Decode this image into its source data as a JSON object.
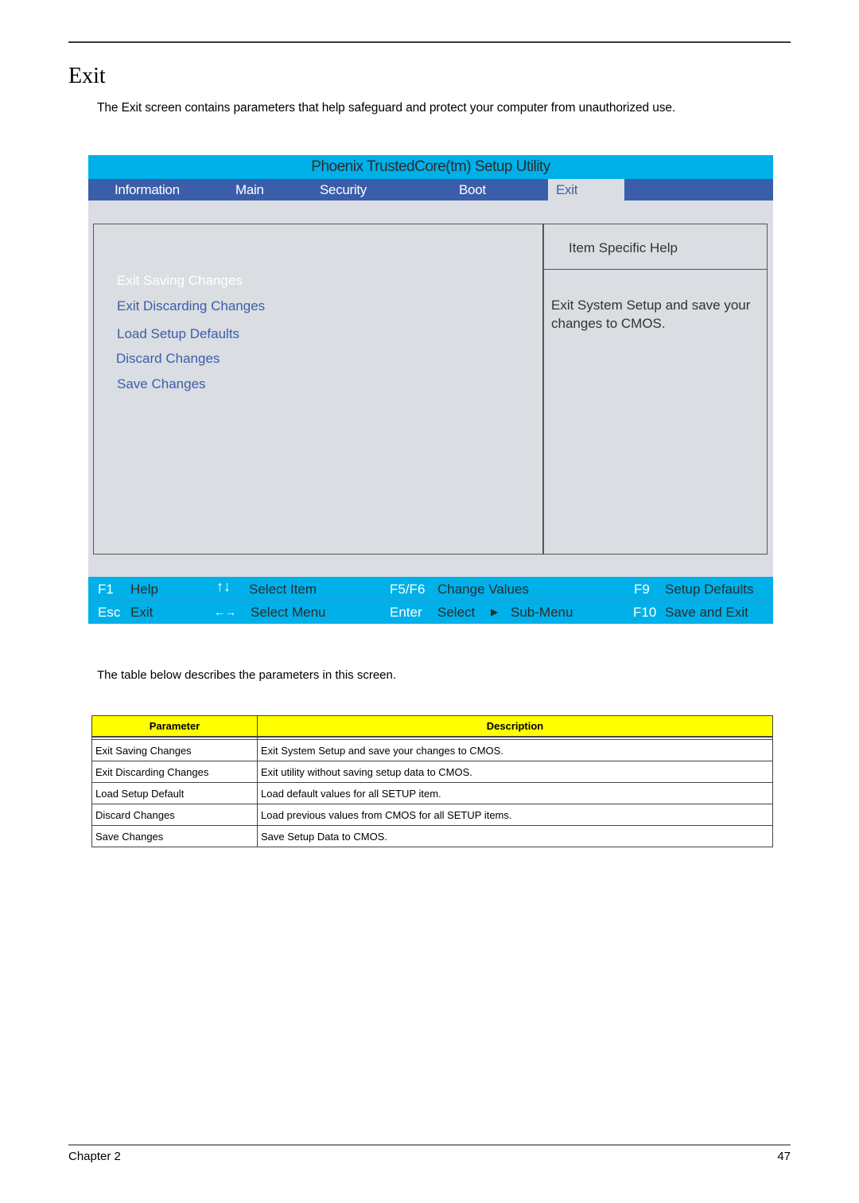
{
  "page": {
    "title": "Exit",
    "intro": "The Exit screen contains parameters that help safeguard and protect your computer from unauthorized use.",
    "table_intro": "The table below describes the parameters in this screen.",
    "footer": {
      "chapter": "Chapter 2",
      "page_number": "47"
    }
  },
  "bios": {
    "title": "Phoenix TrustedCore(tm) Setup Utility",
    "menu": [
      {
        "label": "Information"
      },
      {
        "label": "Main"
      },
      {
        "label": "Security"
      },
      {
        "label": "Boot"
      },
      {
        "label": "Exit",
        "active": true
      }
    ],
    "options": [
      {
        "label": "Exit Saving Changes",
        "selected": true
      },
      {
        "label": "Exit Discarding Changes"
      },
      {
        "label": "Load Setup Defaults"
      },
      {
        "label": "Discard Changes"
      },
      {
        "label": "Save Changes"
      }
    ],
    "help": {
      "title": "Item Specific Help",
      "body": "Exit System Setup and save your changes to CMOS."
    },
    "footer_keys": {
      "f1_key": "F1",
      "f1_desc": "Help",
      "esc_key": "Esc",
      "esc_desc": "Exit",
      "updown_icon": "↑↓",
      "updown_desc": "Select Item",
      "leftright_icon": "←→",
      "leftright_desc": "Select Menu",
      "f5f6_key": "F5/F6",
      "f5f6_desc": "Change Values",
      "enter_key": "Enter",
      "enter_desc": "Select",
      "submenu_icon": "▶",
      "submenu_desc": "Sub-Menu",
      "f9_key": "F9",
      "f9_desc": "Setup Defaults",
      "f10_key": "F10",
      "f10_desc": "Save and Exit"
    },
    "colors": {
      "title_bar": "#00b0e8",
      "menu_bar": "#3b5eaa",
      "panel_bg": "#dadde2",
      "option_text": "#3b5eaa",
      "selected_text": "#ffffff"
    }
  },
  "table": {
    "headers": [
      "Parameter",
      "Description"
    ],
    "rows": [
      [
        "Exit Saving Changes",
        "Exit System Setup and save your changes to CMOS."
      ],
      [
        "Exit Discarding Changes",
        "Exit utility without saving setup data to CMOS."
      ],
      [
        "Load Setup Default",
        "Load default values for all SETUP item."
      ],
      [
        "Discard Changes",
        "Load previous values from CMOS for all SETUP items."
      ],
      [
        "Save Changes",
        "Save Setup Data to CMOS."
      ]
    ],
    "header_color": "#ffff00"
  }
}
